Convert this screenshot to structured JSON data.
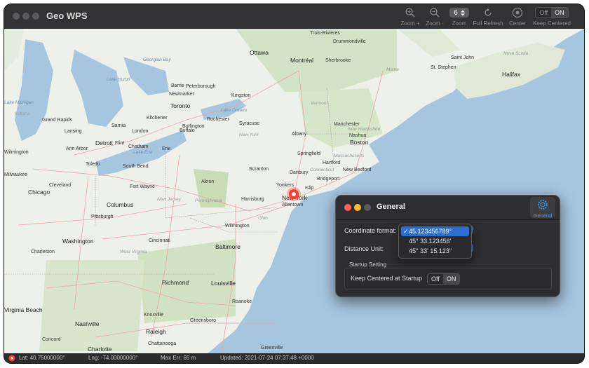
{
  "window": {
    "title": "Geo WPS"
  },
  "toolbar": {
    "zoom_in": "Zoom +",
    "zoom_out": "Zoom -",
    "zoom_label": "Zoom",
    "zoom_value": "6",
    "refresh": "Full Refresh",
    "center": "Center",
    "keep_centered": "Keep Centered",
    "toggle_off": "Off",
    "toggle_on": "ON"
  },
  "map": {
    "labels": [
      {
        "text": "Trois-Rivieres",
        "cls": ""
      },
      {
        "text": "Drummondville",
        "cls": ""
      },
      {
        "text": "Ottawa",
        "cls": "big"
      },
      {
        "text": "Montréal",
        "cls": "big"
      },
      {
        "text": "Sherbrooke",
        "cls": ""
      },
      {
        "text": "Saint John",
        "cls": ""
      },
      {
        "text": "Nova Scotia",
        "cls": "state"
      },
      {
        "text": "Halifax",
        "cls": "big"
      },
      {
        "text": "St. Stephen",
        "cls": ""
      },
      {
        "text": "Maine",
        "cls": "state"
      },
      {
        "text": "Georgian Bay",
        "cls": "water"
      },
      {
        "text": "Barrie",
        "cls": ""
      },
      {
        "text": "Peterborough",
        "cls": ""
      },
      {
        "text": "Newmarket",
        "cls": ""
      },
      {
        "text": "Kingston",
        "cls": ""
      },
      {
        "text": "Lake Huron",
        "cls": "water"
      },
      {
        "text": "Toronto",
        "cls": "big"
      },
      {
        "text": "Lake Ontario",
        "cls": "water"
      },
      {
        "text": "Kitchener",
        "cls": ""
      },
      {
        "text": "Burlington",
        "cls": ""
      },
      {
        "text": "Buffalo",
        "cls": ""
      },
      {
        "text": "Rochester",
        "cls": ""
      },
      {
        "text": "Syracuse",
        "cls": ""
      },
      {
        "text": "Lake Michigan",
        "cls": "water"
      },
      {
        "text": "Grand Rapids",
        "cls": ""
      },
      {
        "text": "Sarnia",
        "cls": ""
      },
      {
        "text": "London",
        "cls": ""
      },
      {
        "text": "Lansing",
        "cls": ""
      },
      {
        "text": "Flint",
        "cls": ""
      },
      {
        "text": "Detroit",
        "cls": "big"
      },
      {
        "text": "Ann Arbor",
        "cls": ""
      },
      {
        "text": "Chatham",
        "cls": ""
      },
      {
        "text": "Lake Erie",
        "cls": "water"
      },
      {
        "text": "Erie",
        "cls": ""
      },
      {
        "text": "New York",
        "cls": "state"
      },
      {
        "text": "Albany",
        "cls": ""
      },
      {
        "text": "Vermont",
        "cls": "state"
      },
      {
        "text": "New Hampshire",
        "cls": "state"
      },
      {
        "text": "Manchester",
        "cls": ""
      },
      {
        "text": "Nashua",
        "cls": ""
      },
      {
        "text": "Boston",
        "cls": "big"
      },
      {
        "text": "Massachusetts",
        "cls": "state"
      },
      {
        "text": "Springfield",
        "cls": ""
      },
      {
        "text": "Hartford",
        "cls": ""
      },
      {
        "text": "Connecticut",
        "cls": "state"
      },
      {
        "text": "New Bedford",
        "cls": ""
      },
      {
        "text": "Danbury",
        "cls": ""
      },
      {
        "text": "Bridgeport",
        "cls": ""
      },
      {
        "text": "Scranton",
        "cls": ""
      },
      {
        "text": "Yonkers",
        "cls": ""
      },
      {
        "text": "Islip",
        "cls": ""
      },
      {
        "text": "New York",
        "cls": "big"
      },
      {
        "text": "Toledo",
        "cls": ""
      },
      {
        "text": "South Bend",
        "cls": ""
      },
      {
        "text": "Cleveland",
        "cls": ""
      },
      {
        "text": "Fort Wayne",
        "cls": ""
      },
      {
        "text": "Akron",
        "cls": ""
      },
      {
        "text": "Pennsylvania",
        "cls": "state"
      },
      {
        "text": "Harrisburg",
        "cls": ""
      },
      {
        "text": "Allentown",
        "cls": ""
      },
      {
        "text": "New Jersey",
        "cls": "state"
      },
      {
        "text": "Pittsburgh",
        "cls": ""
      },
      {
        "text": "Columbus",
        "cls": "big"
      },
      {
        "text": "Ohio",
        "cls": "state"
      },
      {
        "text": "Wilmington",
        "cls": ""
      },
      {
        "text": "Baltimore",
        "cls": "big"
      },
      {
        "text": "Washington",
        "cls": "big"
      },
      {
        "text": "Cincinnati",
        "cls": ""
      },
      {
        "text": "West Virginia",
        "cls": "state"
      },
      {
        "text": "Charleston",
        "cls": ""
      },
      {
        "text": "Louisville",
        "cls": "big"
      },
      {
        "text": "Richmond",
        "cls": "big"
      },
      {
        "text": "Roanoke",
        "cls": ""
      },
      {
        "text": "Virginia Beach",
        "cls": "big"
      },
      {
        "text": "Nashville",
        "cls": "big"
      },
      {
        "text": "Knoxville",
        "cls": ""
      },
      {
        "text": "Greensboro",
        "cls": ""
      },
      {
        "text": "Raleigh",
        "cls": "big"
      },
      {
        "text": "Concord",
        "cls": ""
      },
      {
        "text": "Chattanooga",
        "cls": ""
      },
      {
        "text": "Charlotte",
        "cls": "big"
      },
      {
        "text": "Greenville",
        "cls": ""
      },
      {
        "text": "Wilmington",
        "cls": ""
      },
      {
        "text": "Milwaukee",
        "cls": ""
      },
      {
        "text": "Chicago",
        "cls": "big"
      },
      {
        "text": "Indiana",
        "cls": "state"
      },
      {
        "text": "Michigan",
        "cls": "state"
      }
    ]
  },
  "status": {
    "lat": "Lat:  40.75000000°",
    "lng": "Lng:  -74.00000000°",
    "maxerr": "Max Err:  65 m",
    "updated": "Updated:  2021-07-24 07:37:48 +0000"
  },
  "dialog": {
    "title": "General",
    "tab": "General",
    "coord_label": "Coordinate format:",
    "distance_label": "Distance Unit:",
    "startup_heading": "Startup Setting",
    "keep_centered_label": "Keep Centered at Startup",
    "toggle_off": "Off",
    "toggle_on": "ON",
    "menu": [
      {
        "label": "45.123456789°",
        "selected": true
      },
      {
        "label": "45° 33.123456'",
        "selected": false
      },
      {
        "label": "45° 33' 15.123\"",
        "selected": false
      }
    ]
  }
}
